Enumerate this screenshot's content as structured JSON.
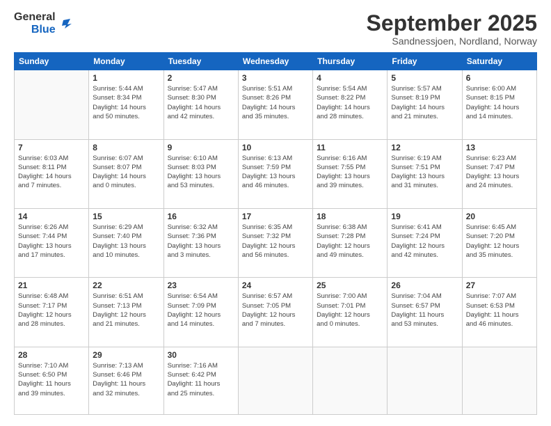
{
  "logo": {
    "line1": "General",
    "line2": "Blue"
  },
  "title": "September 2025",
  "subtitle": "Sandnessjoen, Nordland, Norway",
  "headers": [
    "Sunday",
    "Monday",
    "Tuesday",
    "Wednesday",
    "Thursday",
    "Friday",
    "Saturday"
  ],
  "weeks": [
    [
      {
        "day": "",
        "info": ""
      },
      {
        "day": "1",
        "info": "Sunrise: 5:44 AM\nSunset: 8:34 PM\nDaylight: 14 hours\nand 50 minutes."
      },
      {
        "day": "2",
        "info": "Sunrise: 5:47 AM\nSunset: 8:30 PM\nDaylight: 14 hours\nand 42 minutes."
      },
      {
        "day": "3",
        "info": "Sunrise: 5:51 AM\nSunset: 8:26 PM\nDaylight: 14 hours\nand 35 minutes."
      },
      {
        "day": "4",
        "info": "Sunrise: 5:54 AM\nSunset: 8:22 PM\nDaylight: 14 hours\nand 28 minutes."
      },
      {
        "day": "5",
        "info": "Sunrise: 5:57 AM\nSunset: 8:19 PM\nDaylight: 14 hours\nand 21 minutes."
      },
      {
        "day": "6",
        "info": "Sunrise: 6:00 AM\nSunset: 8:15 PM\nDaylight: 14 hours\nand 14 minutes."
      }
    ],
    [
      {
        "day": "7",
        "info": "Sunrise: 6:03 AM\nSunset: 8:11 PM\nDaylight: 14 hours\nand 7 minutes."
      },
      {
        "day": "8",
        "info": "Sunrise: 6:07 AM\nSunset: 8:07 PM\nDaylight: 14 hours\nand 0 minutes."
      },
      {
        "day": "9",
        "info": "Sunrise: 6:10 AM\nSunset: 8:03 PM\nDaylight: 13 hours\nand 53 minutes."
      },
      {
        "day": "10",
        "info": "Sunrise: 6:13 AM\nSunset: 7:59 PM\nDaylight: 13 hours\nand 46 minutes."
      },
      {
        "day": "11",
        "info": "Sunrise: 6:16 AM\nSunset: 7:55 PM\nDaylight: 13 hours\nand 39 minutes."
      },
      {
        "day": "12",
        "info": "Sunrise: 6:19 AM\nSunset: 7:51 PM\nDaylight: 13 hours\nand 31 minutes."
      },
      {
        "day": "13",
        "info": "Sunrise: 6:23 AM\nSunset: 7:47 PM\nDaylight: 13 hours\nand 24 minutes."
      }
    ],
    [
      {
        "day": "14",
        "info": "Sunrise: 6:26 AM\nSunset: 7:44 PM\nDaylight: 13 hours\nand 17 minutes."
      },
      {
        "day": "15",
        "info": "Sunrise: 6:29 AM\nSunset: 7:40 PM\nDaylight: 13 hours\nand 10 minutes."
      },
      {
        "day": "16",
        "info": "Sunrise: 6:32 AM\nSunset: 7:36 PM\nDaylight: 13 hours\nand 3 minutes."
      },
      {
        "day": "17",
        "info": "Sunrise: 6:35 AM\nSunset: 7:32 PM\nDaylight: 12 hours\nand 56 minutes."
      },
      {
        "day": "18",
        "info": "Sunrise: 6:38 AM\nSunset: 7:28 PM\nDaylight: 12 hours\nand 49 minutes."
      },
      {
        "day": "19",
        "info": "Sunrise: 6:41 AM\nSunset: 7:24 PM\nDaylight: 12 hours\nand 42 minutes."
      },
      {
        "day": "20",
        "info": "Sunrise: 6:45 AM\nSunset: 7:20 PM\nDaylight: 12 hours\nand 35 minutes."
      }
    ],
    [
      {
        "day": "21",
        "info": "Sunrise: 6:48 AM\nSunset: 7:17 PM\nDaylight: 12 hours\nand 28 minutes."
      },
      {
        "day": "22",
        "info": "Sunrise: 6:51 AM\nSunset: 7:13 PM\nDaylight: 12 hours\nand 21 minutes."
      },
      {
        "day": "23",
        "info": "Sunrise: 6:54 AM\nSunset: 7:09 PM\nDaylight: 12 hours\nand 14 minutes."
      },
      {
        "day": "24",
        "info": "Sunrise: 6:57 AM\nSunset: 7:05 PM\nDaylight: 12 hours\nand 7 minutes."
      },
      {
        "day": "25",
        "info": "Sunrise: 7:00 AM\nSunset: 7:01 PM\nDaylight: 12 hours\nand 0 minutes."
      },
      {
        "day": "26",
        "info": "Sunrise: 7:04 AM\nSunset: 6:57 PM\nDaylight: 11 hours\nand 53 minutes."
      },
      {
        "day": "27",
        "info": "Sunrise: 7:07 AM\nSunset: 6:53 PM\nDaylight: 11 hours\nand 46 minutes."
      }
    ],
    [
      {
        "day": "28",
        "info": "Sunrise: 7:10 AM\nSunset: 6:50 PM\nDaylight: 11 hours\nand 39 minutes."
      },
      {
        "day": "29",
        "info": "Sunrise: 7:13 AM\nSunset: 6:46 PM\nDaylight: 11 hours\nand 32 minutes."
      },
      {
        "day": "30",
        "info": "Sunrise: 7:16 AM\nSunset: 6:42 PM\nDaylight: 11 hours\nand 25 minutes."
      },
      {
        "day": "",
        "info": ""
      },
      {
        "day": "",
        "info": ""
      },
      {
        "day": "",
        "info": ""
      },
      {
        "day": "",
        "info": ""
      }
    ]
  ]
}
